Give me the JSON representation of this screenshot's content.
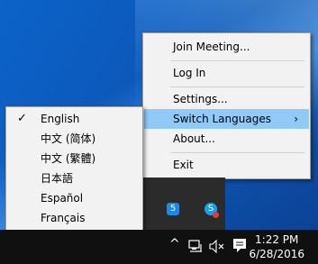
{
  "main_menu": {
    "items": [
      {
        "label": "Join Meeting..."
      },
      {
        "label": "Log In"
      },
      {
        "label": "Settings..."
      },
      {
        "label": "Switch Languages"
      },
      {
        "label": "About..."
      },
      {
        "label": "Exit"
      }
    ],
    "submenu_arrow": "›"
  },
  "languages_menu": {
    "selected_mark": "✓",
    "items": [
      {
        "label": "English"
      },
      {
        "label": "中文 (简体)"
      },
      {
        "label": "中文 (繁體)"
      },
      {
        "label": "日本語"
      },
      {
        "label": "Español"
      },
      {
        "label": "Français"
      }
    ]
  },
  "tray_overflow": {
    "icons": [
      {
        "icon": "5-badge-icon",
        "glyph": "5"
      },
      {
        "icon": "skype-status-icon",
        "glyph": "S"
      }
    ]
  },
  "taskbar": {
    "up_arrow": "^",
    "network_icon": "network-icon",
    "volume_icon": "muted-volume-icon",
    "notification_icon": "action-center-icon",
    "time": "1:22 PM",
    "date": "6/28/2016"
  },
  "colors": {
    "highlight": "#91c9f7",
    "menu_bg": "#f2f2f2",
    "taskbar_bg": "#101010"
  }
}
